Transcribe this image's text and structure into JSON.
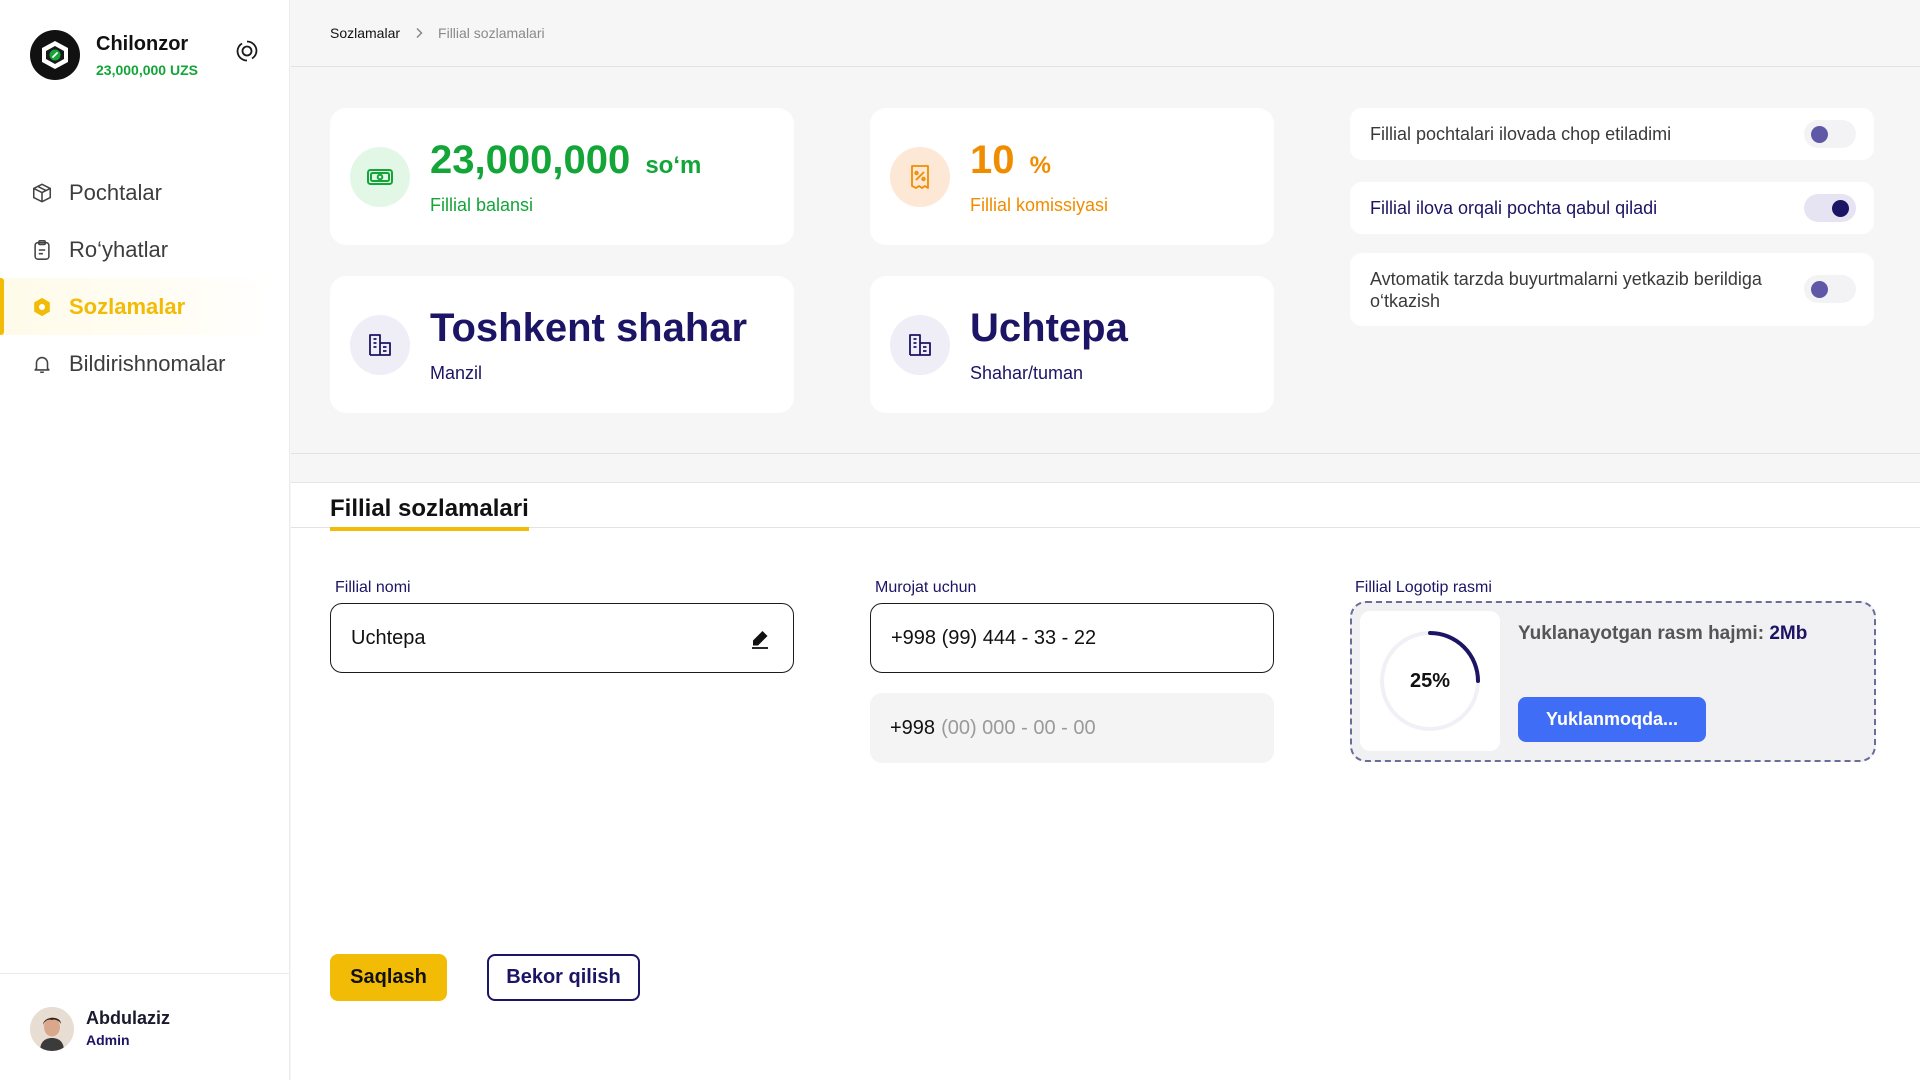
{
  "brand": {
    "name": "Chilonzor",
    "balance": "23,000,000 UZS"
  },
  "nav": [
    {
      "label": "Pochtalar",
      "icon": "package-icon"
    },
    {
      "label": "Ro‘yhatlar",
      "icon": "clipboard-icon"
    },
    {
      "label": "Sozlamalar",
      "icon": "settings-icon",
      "active": true
    },
    {
      "label": "Bildirishnomalar",
      "icon": "bell-icon"
    }
  ],
  "user": {
    "name": "Abdulaziz",
    "role": "Admin"
  },
  "breadcrumb": {
    "parent": "Sozlamalar",
    "current": "Fillial sozlamalari"
  },
  "stats": {
    "balance": {
      "value": "23,000,000",
      "unit": "so‘m",
      "label": "Fillial balansi",
      "color": "#13a538"
    },
    "commission": {
      "value": "10",
      "unit": "%",
      "label": "Fillial komissiyasi",
      "color": "#f08c00"
    },
    "address": {
      "value": "Toshkent shahar",
      "label": "Manzil",
      "color": "#1c1464"
    },
    "district": {
      "value": "Uchtepa",
      "label": "Shahar/tuman",
      "color": "#1c1464"
    }
  },
  "toggles": [
    {
      "label": "Fillial pochtalari ilovada chop etiladimi",
      "on": false
    },
    {
      "label": "Fillial ilova orqali pochta qabul qiladi",
      "on": true
    },
    {
      "label": "Avtomatik tarzda buyurtmalarni yetkazib berildiga o‘tkazish",
      "on": false
    }
  ],
  "section_title": "Fillial sozlamalari",
  "form": {
    "name_label": "Fillial nomi",
    "name_value": "Uchtepa",
    "contact_label": "Murojat uchun",
    "phone_1": "+998 (99) 444 - 33 - 22",
    "phone_2_prefix": "+998",
    "phone_2_placeholder": "(00) 000 - 00 - 00",
    "logo_label": "Fillial Logotip rasmi",
    "upload_progress_text": "25%",
    "upload_progress": 0.25,
    "upload_size_label": "Yuklanayotgan rasm hajmi:",
    "upload_size_value": "2Mb",
    "upload_button": "Yuklanmoqda..."
  },
  "actions": {
    "save": "Saqlash",
    "cancel": "Bekor qilish"
  },
  "colors": {
    "accent": "#f2bb05",
    "navy": "#1c1464",
    "green": "#13a538",
    "orange": "#f08c00",
    "blue": "#3f6df6"
  }
}
